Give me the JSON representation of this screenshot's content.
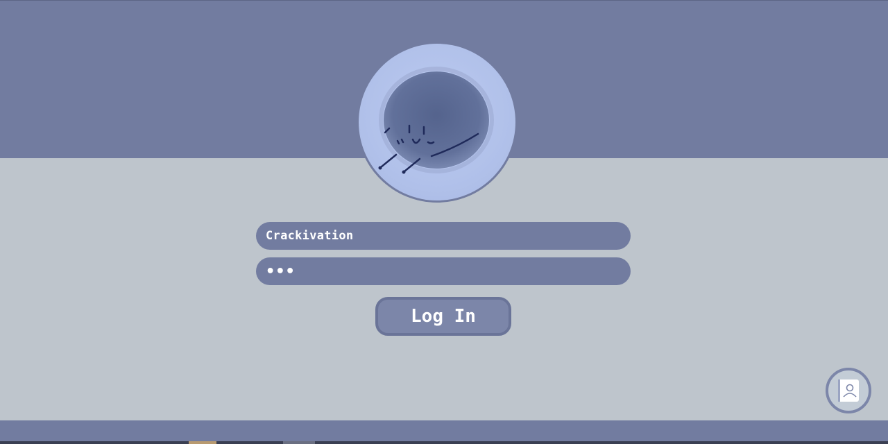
{
  "login": {
    "username_value": "Crackivation",
    "password_value": "•••",
    "login_label": "Log In"
  },
  "icons": {
    "avatar": "fluffy-blob-avatar",
    "contacts": "contact-book-icon"
  },
  "colors": {
    "band": "#727ca0",
    "background": "#bec5cc",
    "avatar_bg": "#b1c1ea",
    "field_bg": "#727ca0",
    "text": "#ffffff"
  }
}
